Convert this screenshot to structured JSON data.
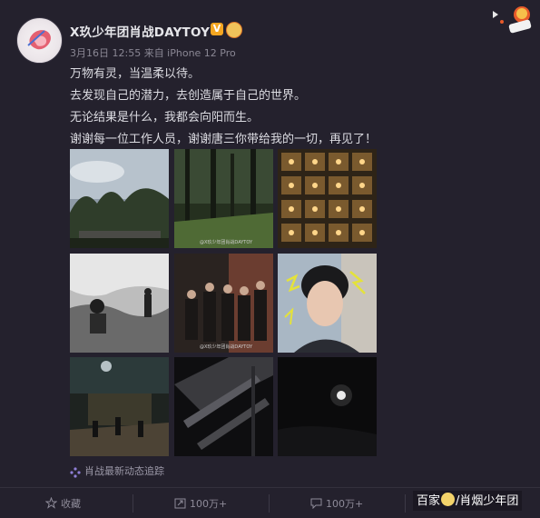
{
  "post": {
    "username": "X玖少年团肖战DAYTOY",
    "verified_badge": "V",
    "meta": "3月16日 12:55 来自 iPhone 12 Pro",
    "lines": [
      "万物有灵，当温柔以待。",
      "去发现自己的潜力，去创造属于自己的世界。",
      "无论结果是什么，我都会向阳而生。",
      "谢谢每一位工作人员，谢谢唐三你带给我的一切，再见了！"
    ],
    "photo_watermark": "@X玖少年团肖战DAYTOY",
    "source_label": "肖战最新动态追踪"
  },
  "actions": {
    "favorite": "收藏",
    "repost": "100万+",
    "comment": "100万+"
  },
  "brand_watermark": {
    "left": "百家",
    "right": "/肖烟少年团"
  },
  "colors": {
    "background": "#24212d",
    "verified": "#f4a621"
  }
}
